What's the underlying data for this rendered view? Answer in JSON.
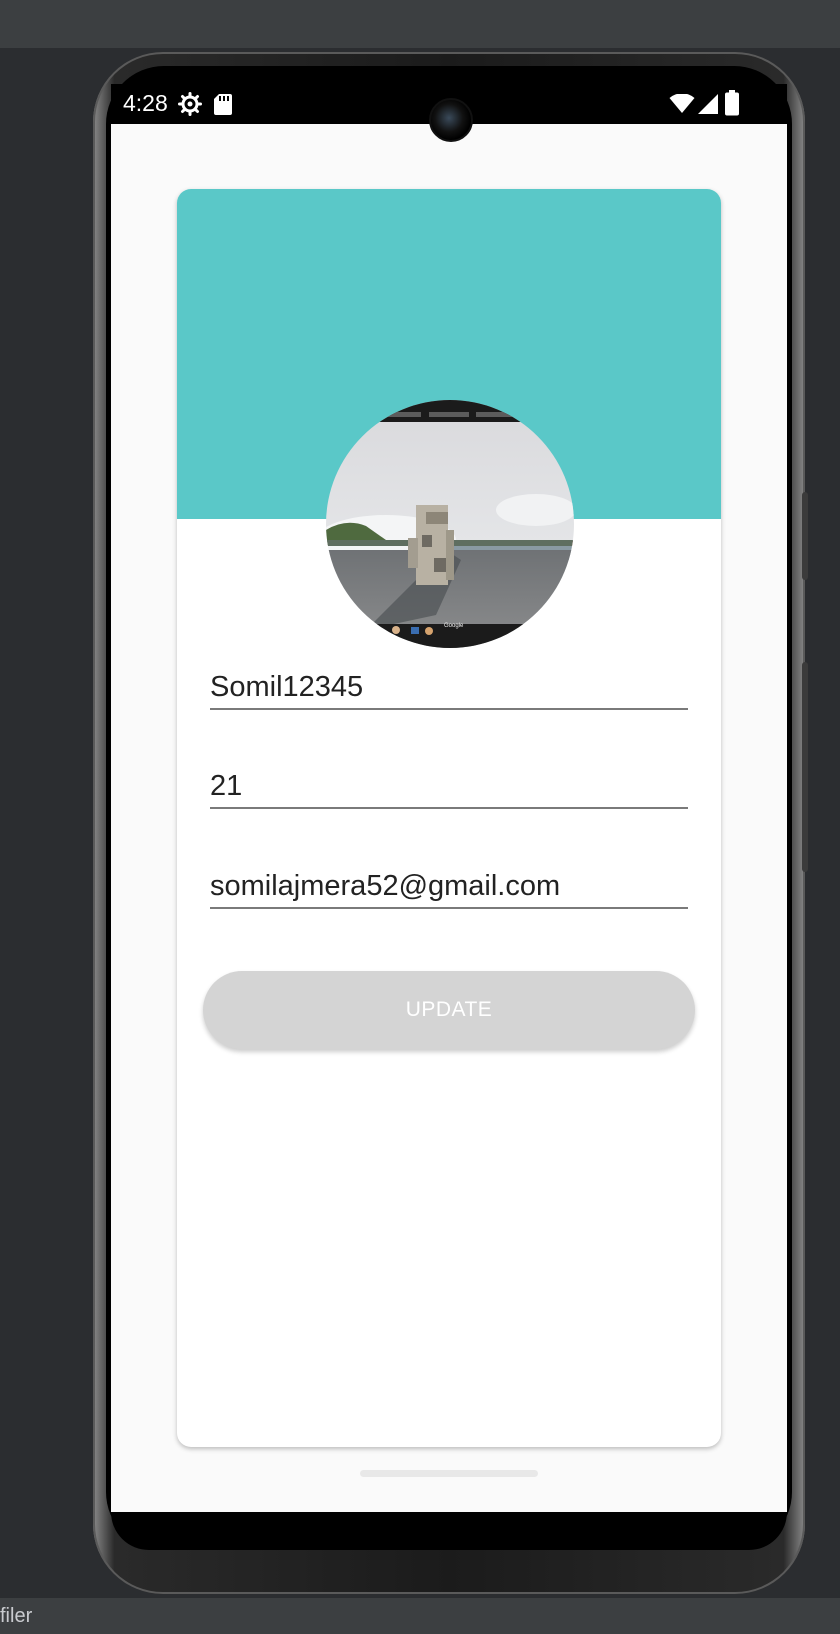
{
  "ide": {
    "bottom_label": "filer"
  },
  "statusbar": {
    "time": "4:28",
    "icons_left": [
      "gear-icon",
      "sd-card-icon"
    ],
    "icons_right": [
      "wifi-icon",
      "signal-icon",
      "battery-icon"
    ]
  },
  "profile": {
    "header_color": "#5ac8c8",
    "avatar": "street-view-photo",
    "username": "Somil12345",
    "age": "21",
    "email": "somilajmera52@gmail.com",
    "update_label": "UPDATE"
  },
  "colors": {
    "accent": "#5ac8c8",
    "button_disabled": "#d4d4d4"
  }
}
